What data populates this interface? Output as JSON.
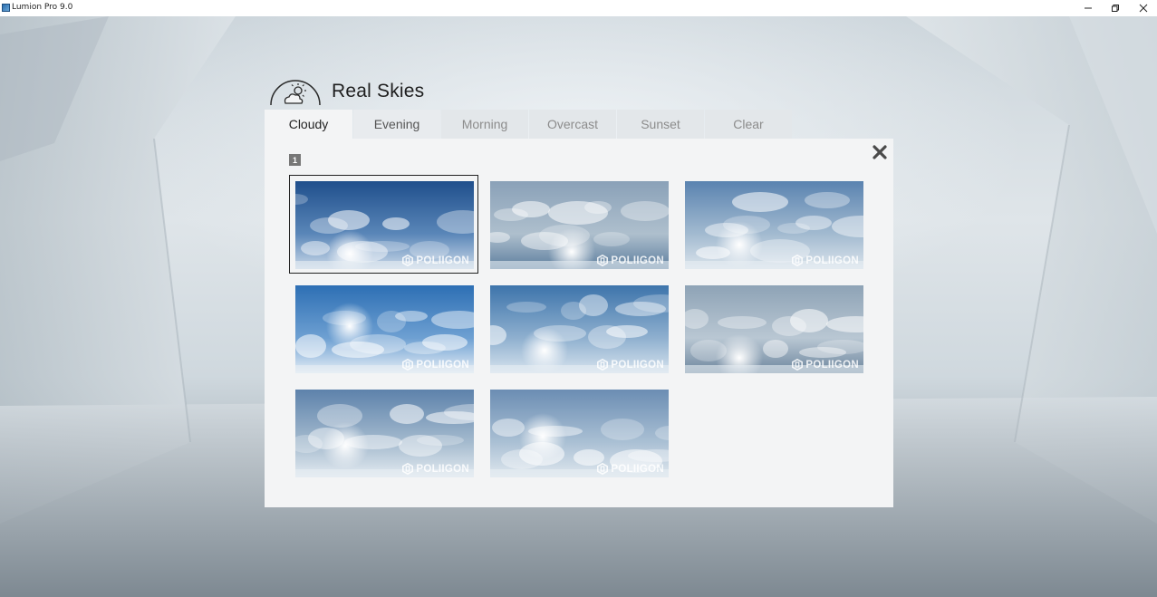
{
  "window": {
    "title": "Lumion Pro 9.0",
    "controls": [
      "minimize",
      "restore",
      "close"
    ]
  },
  "panel": {
    "title": "Real Skies",
    "icon": "cloud-sun-icon",
    "tabs": [
      {
        "label": "Cloudy",
        "active": true
      },
      {
        "label": "Evening",
        "active": false
      },
      {
        "label": "Morning",
        "active": false
      },
      {
        "label": "Overcast",
        "active": false
      },
      {
        "label": "Sunset",
        "active": false
      },
      {
        "label": "Clear",
        "active": false
      }
    ],
    "page_number": "1",
    "watermark": "POLIIGON",
    "selected_index": 0,
    "skies": [
      {
        "id": "sky-1"
      },
      {
        "id": "sky-2"
      },
      {
        "id": "sky-3"
      },
      {
        "id": "sky-4"
      },
      {
        "id": "sky-5"
      },
      {
        "id": "sky-6"
      },
      {
        "id": "sky-7"
      },
      {
        "id": "sky-8"
      }
    ]
  },
  "colors": {
    "panel_bg": "#f3f4f5",
    "tab_inactive_bg": "#e3e7ea",
    "tab_inactive_text": "#8c8c8c",
    "tab_active_text": "#222222",
    "selection_border": "#222222"
  }
}
